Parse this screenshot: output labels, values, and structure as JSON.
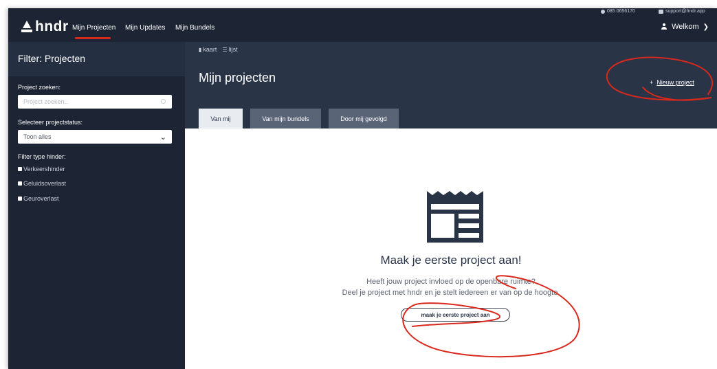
{
  "contact": {
    "phone": "085 0656170",
    "email": "support@hndr.app",
    "phone_icon": "phone-icon",
    "mail_icon": "mail-icon"
  },
  "nav": {
    "logo": "hndr",
    "items": [
      {
        "label": "Mijn Projecten",
        "active": true
      },
      {
        "label": "Mijn Updates"
      },
      {
        "label": "Mijn Bundels"
      }
    ],
    "welcome": "Welkom"
  },
  "sidebar": {
    "title": "Filter: Projecten",
    "search_label": "Project zoeken:",
    "search_placeholder": "Project zoeken..",
    "status_label": "Selecteer projectstatus:",
    "status_value": "Toon alles",
    "type_label": "Filter type hinder:",
    "types": [
      {
        "label": "Verkeershinder"
      },
      {
        "label": "Geluidsoverlast"
      },
      {
        "label": "Geuroverlast"
      }
    ]
  },
  "main": {
    "view_toggle": {
      "map": "kaart",
      "list": "lijst"
    },
    "title": "Mijn projecten",
    "new_project_plus": "+",
    "new_project": "Nieuw project",
    "tabs": [
      {
        "label": "Van mij",
        "active": true
      },
      {
        "label": "Van mijn bundels"
      },
      {
        "label": "Door mij gevolgd"
      }
    ]
  },
  "empty_state": {
    "icon": "newspaper-icon",
    "title": "Maak je eerste project aan!",
    "line1": "Heeft jouw project invloed op de openbare ruimte?",
    "line2": "Deel je project met hndr en je stelt iedereen er van op de hoogte.",
    "cta": "maak je eerste project aan"
  },
  "colors": {
    "nav_bg": "#1d2433",
    "header_bg": "#2a3447",
    "accent_red": "#d9281c"
  }
}
